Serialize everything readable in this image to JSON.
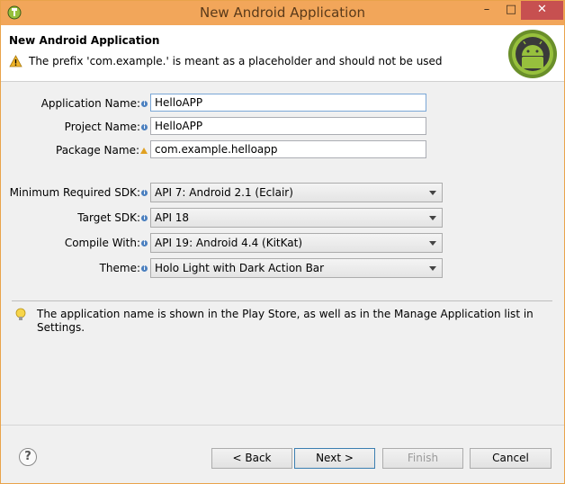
{
  "window": {
    "title": "New Android Application",
    "minimize": "–",
    "maximize": "□",
    "close": "✕"
  },
  "header": {
    "title": "New Android Application",
    "message": "The prefix 'com.example.' is meant as a placeholder and should not be used"
  },
  "form": {
    "application_name": {
      "label": "Application Name:",
      "value": "HelloAPP"
    },
    "project_name": {
      "label": "Project Name:",
      "value": "HelloAPP"
    },
    "package_name": {
      "label": "Package Name:",
      "value": "com.example.helloapp"
    },
    "min_sdk": {
      "label": "Minimum Required SDK:",
      "value": "API 7: Android 2.1 (Eclair)"
    },
    "target_sdk": {
      "label": "Target SDK:",
      "value": "API 18"
    },
    "compile_with": {
      "label": "Compile With:",
      "value": "API 19: Android 4.4 (KitKat)"
    },
    "theme": {
      "label": "Theme:",
      "value": "Holo Light with Dark Action Bar"
    }
  },
  "hint": {
    "text": "The application name is shown in the Play Store, as well as in the Manage Application list in Settings."
  },
  "buttons": {
    "help": "?",
    "back": "< Back",
    "next": "Next >",
    "finish": "Finish",
    "cancel": "Cancel"
  },
  "colors": {
    "titlebar": "#f2a65a",
    "close": "#c75050",
    "android_green": "#97c03d"
  }
}
